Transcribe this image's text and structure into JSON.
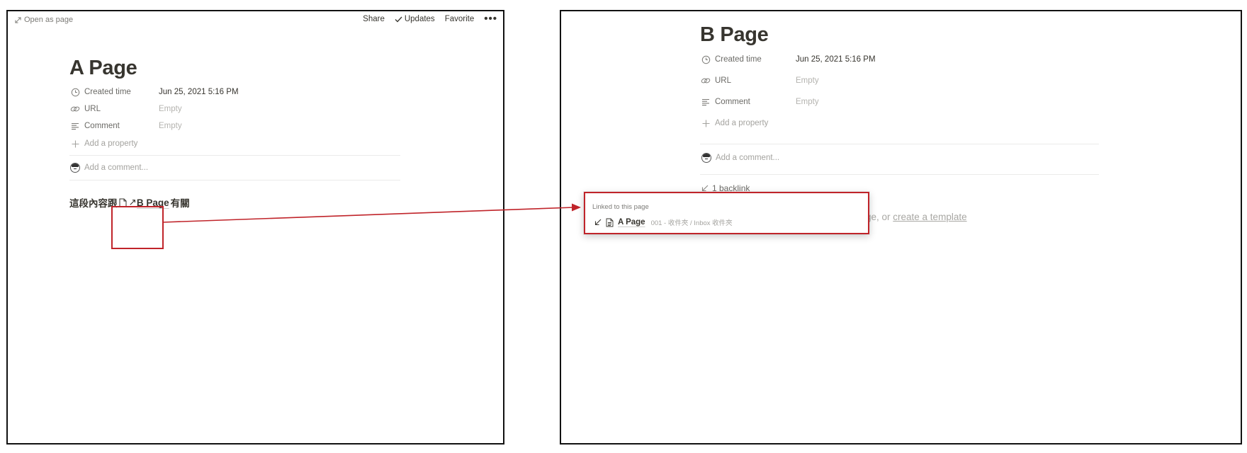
{
  "panel_a": {
    "open_as_page": "Open as page",
    "topbar": {
      "share": "Share",
      "updates": "Updates",
      "favorite": "Favorite",
      "more": "•••"
    },
    "title": "A Page",
    "properties": [
      {
        "name": "Created time",
        "value": "Jun 25, 2021 5:16 PM",
        "icon": "clock-icon"
      },
      {
        "name": "URL",
        "value": "Empty",
        "icon": "link-icon"
      },
      {
        "name": "Comment",
        "value": "Empty",
        "icon": "text-lines-icon"
      }
    ],
    "add_property": "Add a property",
    "comment_placeholder": "Add a comment...",
    "body_prefix": "這段內容跟",
    "mention_arrow": "↗",
    "mention_label": "B Page",
    "body_suffix": "有關"
  },
  "panel_b": {
    "title": "B Page",
    "properties": [
      {
        "name": "Created time",
        "value": "Jun 25, 2021 5:16 PM",
        "icon": "clock-icon"
      },
      {
        "name": "URL",
        "value": "Empty",
        "icon": "link-icon"
      },
      {
        "name": "Comment",
        "value": "Empty",
        "icon": "text-lines-icon"
      }
    ],
    "add_property": "Add a property",
    "comment_placeholder": "Add a comment...",
    "backlinks": "1 backlink",
    "background_text_prefix": "ge, or ",
    "background_text_link": "create a template"
  },
  "popup": {
    "header": "Linked to this page",
    "item_name": "A Page",
    "item_path": "001 - 收件夾 / Inbox 收件夾"
  },
  "colors": {
    "annotation_red": "#c0242a",
    "text": "#37352f",
    "muted": "#a4a39f"
  }
}
